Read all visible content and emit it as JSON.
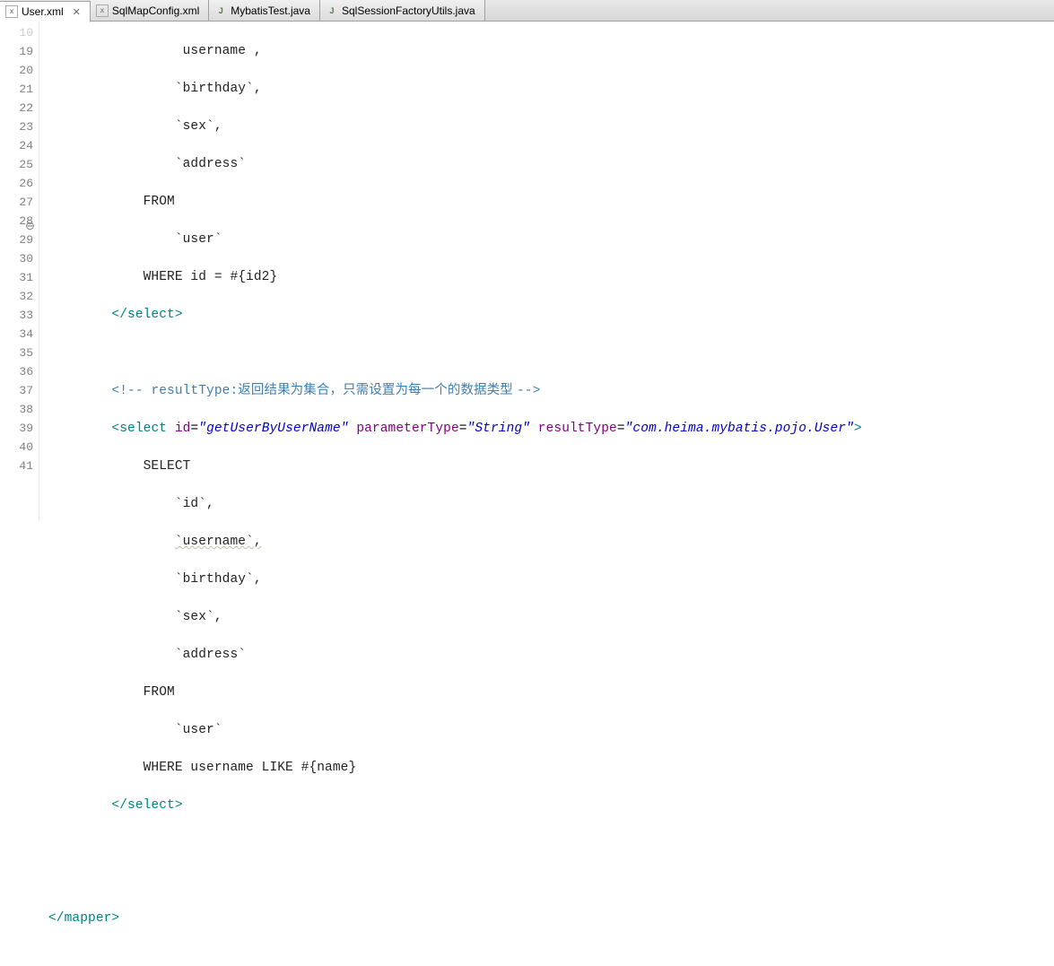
{
  "tabs": [
    {
      "label": "User.xml",
      "icon": "xml",
      "active": true,
      "closeable": true
    },
    {
      "label": "SqlMapConfig.xml",
      "icon": "xml",
      "active": false,
      "closeable": false
    },
    {
      "label": "MybatisTest.java",
      "icon": "java",
      "active": false,
      "closeable": false
    },
    {
      "label": "SqlSessionFactoryUtils.java",
      "icon": "java",
      "active": false,
      "closeable": false
    }
  ],
  "gutter": {
    "start": 18,
    "truncated_first": "10",
    "fold_at": 28,
    "lines": [
      19,
      20,
      21,
      22,
      23,
      24,
      25,
      26,
      27,
      28,
      29,
      30,
      31,
      32,
      33,
      34,
      35,
      36,
      37,
      38,
      39,
      40,
      41
    ]
  },
  "code": {
    "indent2": "    ",
    "indent3": "        ",
    "indent4": "            ",
    "indent5": "                ",
    "l18": "                 username ,",
    "l19": "`birthday`,",
    "l20": "`sex`,",
    "l21": "`address`",
    "l22": "FROM",
    "l23": "`user`",
    "l24": "WHERE id = #{id2}",
    "l25_open": "</",
    "l25_tag": "select",
    "l25_close": ">",
    "l27_cmt_open": "<!-- ",
    "l27_cmt_key": "resultType:",
    "l27_cmt_txt": "返回结果为集合，只需设置为每一个的数据类型 ",
    "l27_cmt_close": "-->",
    "l28_open": "<",
    "l28_tag": "select",
    "l28_sp": " ",
    "l28_a1": "id",
    "l28_e": "=",
    "l28_v1": "\"getUserByUserName\"",
    "l28_a2": "parameterType",
    "l28_v2": "\"String\"",
    "l28_a3": "resultType",
    "l28_v3": "\"com.heima.mybatis.pojo.User\"",
    "l28_close": ">",
    "l29": "SELECT",
    "l30": "`id`,",
    "l31": "`username`,",
    "l32": "`birthday`,",
    "l33": "`sex`,",
    "l34": "`address`",
    "l35": "FROM",
    "l36": "`user`",
    "l37": "WHERE username LIKE #{name}",
    "l38_open": "</",
    "l38_tag": "select",
    "l38_close": ">",
    "l41_open": "</",
    "l41_tag": "mapper",
    "l41_close": ">"
  }
}
